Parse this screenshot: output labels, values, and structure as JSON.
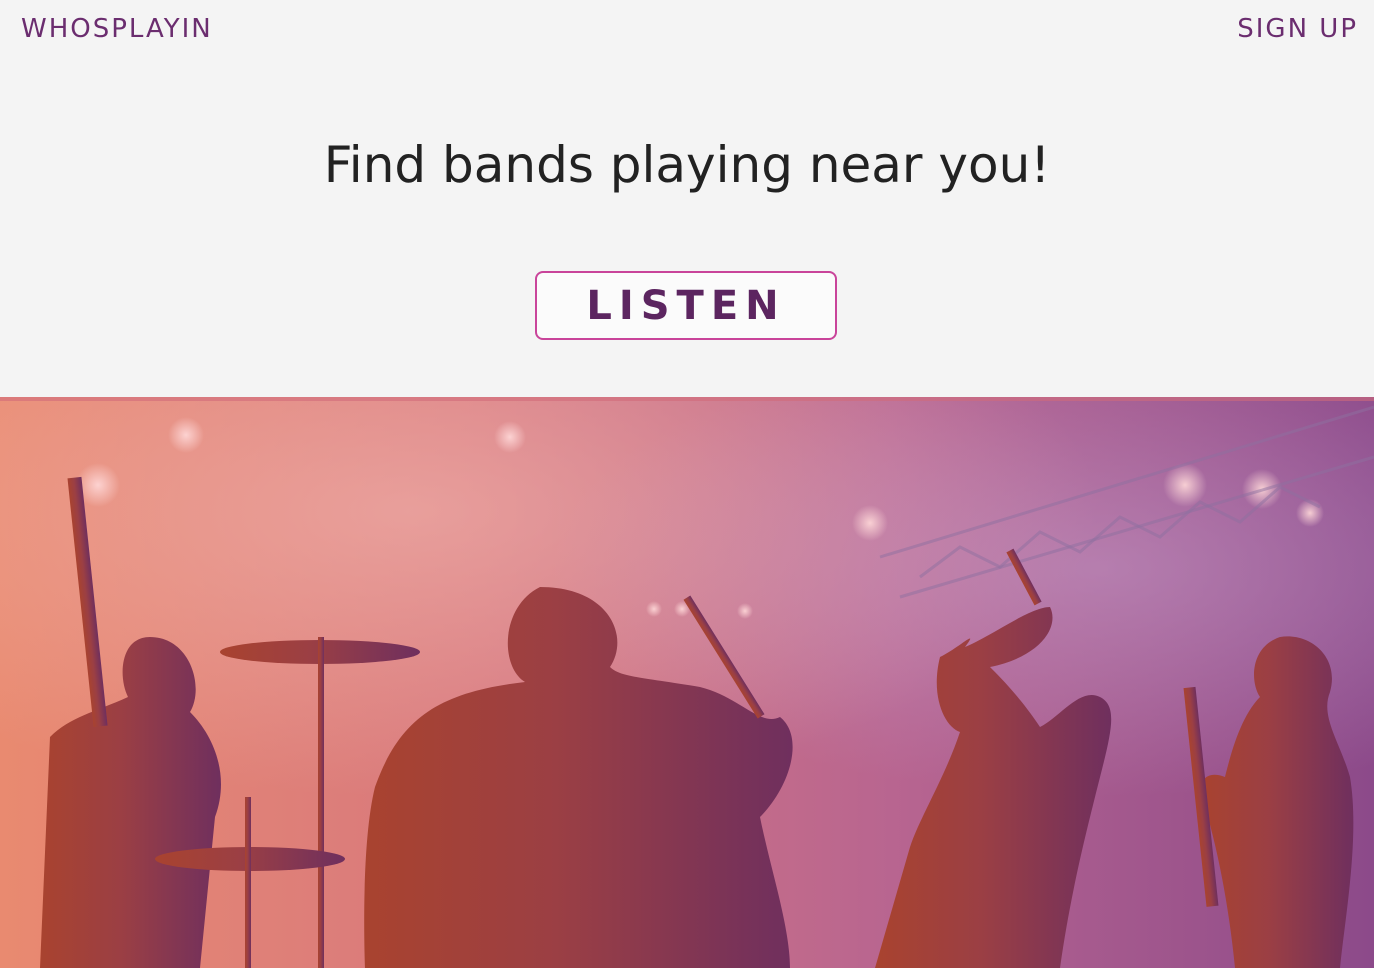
{
  "header": {
    "brand": "WHOSPLAYIN",
    "signup_label": "SIGN UP"
  },
  "main": {
    "headline": "Find bands playing near you!",
    "cta_label": "LISTEN"
  },
  "hero": {
    "image_icon": "concert-band-silhouette",
    "overlay_colors": [
      "#e07a5f",
      "#d0687a",
      "#9a4a86",
      "#7f3a80"
    ]
  },
  "colors": {
    "brand": "#6b2d6f",
    "cta_border": "#c9449a",
    "background": "#f4f4f4"
  }
}
